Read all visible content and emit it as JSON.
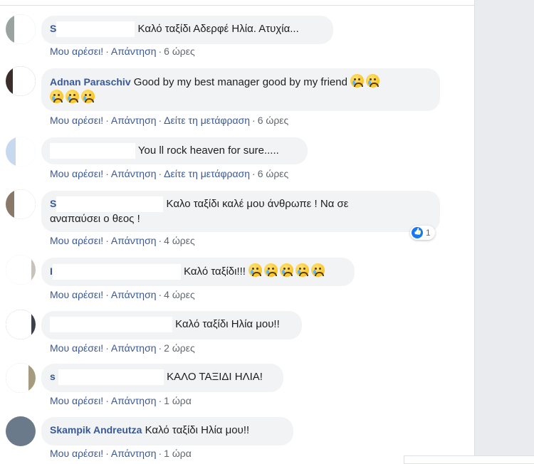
{
  "comments": [
    {
      "name": "S",
      "text": "Καλό ταξίδι Αδερφέ Ηλία. Ατυχία...",
      "actions": [
        "Μου αρέσει!",
        "Απάντηση"
      ],
      "time": "6 ώρες"
    },
    {
      "name": "Adnan Paraschiv",
      "text": "Good by my best manager good by my friend",
      "actions": [
        "Μου αρέσει!",
        "Απάντηση",
        "Δείτε τη μετάφραση"
      ],
      "time": "6 ώρες",
      "emoji_count": 5
    },
    {
      "name": "",
      "text": "You ll rock heaven for sure.....",
      "actions": [
        "Μου αρέσει!",
        "Απάντηση",
        "Δείτε τη μετάφραση"
      ],
      "time": "6 ώρες"
    },
    {
      "name": "S",
      "text_line1": "Καλο ταξίδι καλέ μου άνθρωπε ! Να σε",
      "text_line2": "αναπαύσει ο θεος !",
      "actions": [
        "Μου αρέσει!",
        "Απάντηση"
      ],
      "time": "4 ώρες",
      "reaction_count": "1"
    },
    {
      "name": "I",
      "text": "Καλό ταξίδι!!!",
      "actions": [
        "Μου αρέσει!",
        "Απάντηση"
      ],
      "time": "4 ώρες",
      "emoji_count": 5
    },
    {
      "name": "",
      "text": "Καλό ταξίδι Ηλία μου!!",
      "actions": [
        "Μου αρέσει!",
        "Απάντηση"
      ],
      "time": "2 ώρες"
    },
    {
      "name": "s",
      "text": "ΚΑΛΟ ΤΑΞΙΔΙ ΗΛΙΑ!",
      "actions": [
        "Μου αρέσει!",
        "Απάντηση"
      ],
      "time": "1 ώρα"
    },
    {
      "name": "Skampik Andreutza",
      "text": "Καλό ταξίδι Ηλία μου!!",
      "actions": [
        "Μου αρέσει!",
        "Απάντηση"
      ],
      "time": "1 ώρα"
    }
  ],
  "colors": {
    "link": "#385898",
    "meta": "#606770",
    "bubble": "#f2f3f5",
    "like": "#1877f2"
  },
  "icons": {
    "emoji": "crying-face-icon",
    "reaction": "like-icon"
  }
}
